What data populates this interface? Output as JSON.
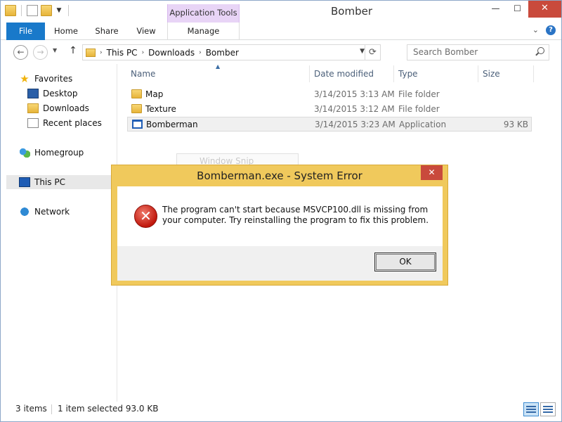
{
  "window": {
    "title": "Bomber",
    "contextual_tab": "Application Tools",
    "controls": {
      "minimize": "—",
      "maximize": "☐",
      "close": "✕"
    }
  },
  "ribbon": {
    "tabs": [
      "File",
      "Home",
      "Share",
      "View",
      "Manage"
    ],
    "active_tab": "File",
    "accent": "#1979ca"
  },
  "address": {
    "breadcrumbs": [
      "This PC",
      "Downloads",
      "Bomber"
    ],
    "search_placeholder": "Search Bomber"
  },
  "navpane": {
    "favorites": "Favorites",
    "favorites_items": [
      "Desktop",
      "Downloads",
      "Recent places"
    ],
    "homegroup": "Homegroup",
    "this_pc": "This PC",
    "network": "Network"
  },
  "columns": {
    "name": "Name",
    "date": "Date modified",
    "type": "Type",
    "size": "Size"
  },
  "files": [
    {
      "name": "Map",
      "date": "3/14/2015 3:13 AM",
      "type": "File folder",
      "size": "",
      "icon": "folder-icon"
    },
    {
      "name": "Texture",
      "date": "3/14/2015 3:12 AM",
      "type": "File folder",
      "size": "",
      "icon": "folder-icon"
    },
    {
      "name": "Bomberman",
      "date": "3/14/2015 3:23 AM",
      "type": "Application",
      "size": "93 KB",
      "icon": "application-icon"
    }
  ],
  "ghost_snip": "Window Snip",
  "status": {
    "count": "3 items",
    "selection": "1 item selected  93.0 KB"
  },
  "dialog": {
    "title": "Bomberman.exe - System Error",
    "message": "The program can't start because MSVCP100.dll is missing from your computer. Try reinstalling the program to fix this problem.",
    "ok": "OK",
    "close": "✕",
    "border_color": "#f0c95c"
  }
}
